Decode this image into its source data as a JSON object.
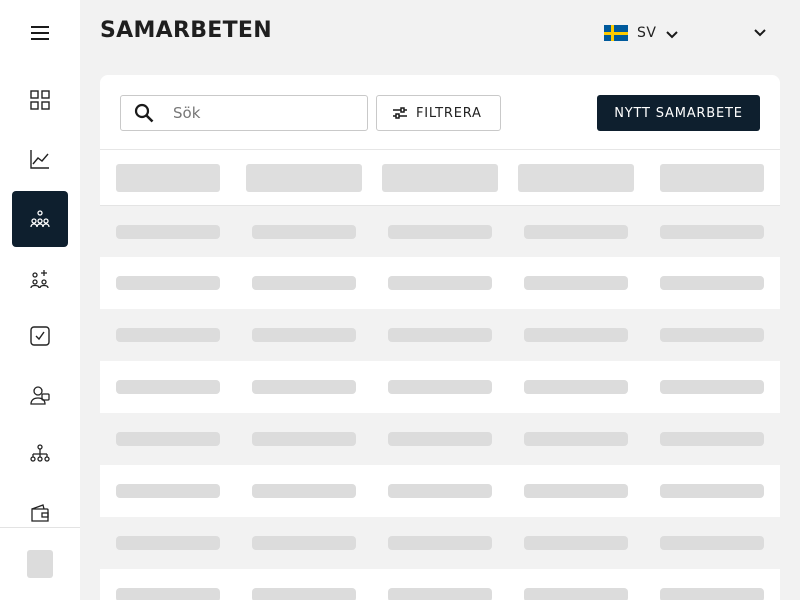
{
  "sidebar": {
    "menu_icon": "hamburger-menu-icon",
    "items": [
      {
        "name": "dashboard",
        "icon": "grid-icon",
        "active": false
      },
      {
        "name": "analytics",
        "icon": "line-chart-icon",
        "active": false
      },
      {
        "name": "collaborations",
        "icon": "people-network-icon",
        "active": true
      },
      {
        "name": "partners",
        "icon": "people-add-icon",
        "active": false
      },
      {
        "name": "tasks",
        "icon": "checkbox-icon",
        "active": false
      },
      {
        "name": "contacts",
        "icon": "contact-icon",
        "active": false
      },
      {
        "name": "organization",
        "icon": "org-tree-icon",
        "active": false
      },
      {
        "name": "wallet",
        "icon": "wallet-icon",
        "active": false
      }
    ]
  },
  "header": {
    "title": "SAMARBETEN",
    "language": {
      "code": "SV",
      "flag": "sweden-flag-icon"
    }
  },
  "toolbar": {
    "search_placeholder": "Sök",
    "filter_label": "FILTRERA",
    "new_button_label": "NYTT SAMARBETE"
  },
  "table": {
    "loading": true,
    "columns": 5,
    "skeleton_rows": 8
  },
  "colors": {
    "accent": "#0e1f2e",
    "background": "#f2f2f2",
    "skeleton": "#dcdcdc"
  }
}
